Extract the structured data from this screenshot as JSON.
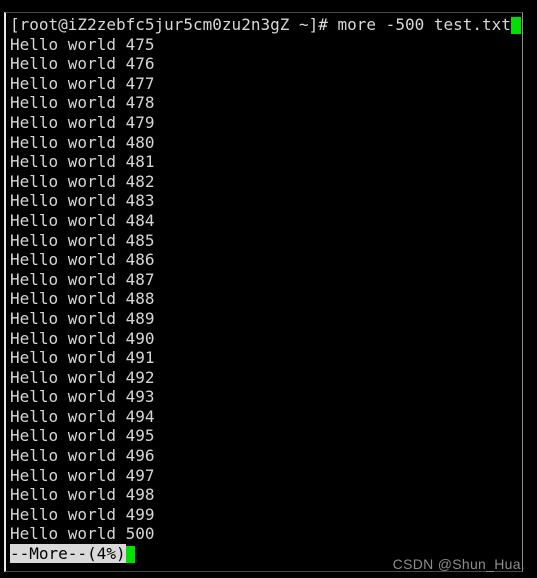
{
  "terminal": {
    "prompt": {
      "text": "[root@iZ2zebfc5jur5cm0zu2n3gZ ~]# more -500 test.txt",
      "user": "root",
      "host": "iZ2zebfc5jur5cm0zu2n3gZ",
      "cwd": "~",
      "symbol": "#",
      "command": "more -500 test.txt"
    },
    "output_lines": [
      "Hello world 475",
      "Hello world 476",
      "Hello world 477",
      "Hello world 478",
      "Hello world 479",
      "Hello world 480",
      "Hello world 481",
      "Hello world 482",
      "Hello world 483",
      "Hello world 484",
      "Hello world 485",
      "Hello world 486",
      "Hello world 487",
      "Hello world 488",
      "Hello world 489",
      "Hello world 490",
      "Hello world 491",
      "Hello world 492",
      "Hello world 493",
      "Hello world 494",
      "Hello world 495",
      "Hello world 496",
      "Hello world 497",
      "Hello world 498",
      "Hello world 499",
      "Hello world 500"
    ],
    "status": {
      "text": "--More--(4%)",
      "percent": "4%"
    },
    "colors": {
      "background": "#000000",
      "foreground": "#d6d6d6",
      "cursor": "#00e000",
      "status_background": "#d9d9d9",
      "status_foreground": "#000000",
      "watermark": "#8d8d8d"
    }
  },
  "watermark": {
    "text": "CSDN @Shun_Hua."
  }
}
